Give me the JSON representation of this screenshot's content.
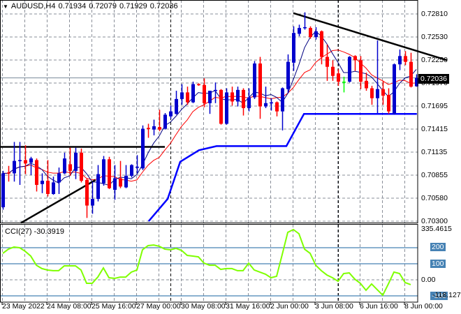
{
  "header": {
    "symbol": "AUDUSD,H4",
    "open": "0.71934",
    "high": "0.72079",
    "low": "0.71929",
    "close": "0.72036",
    "menu_icon": "triangle-down-icon"
  },
  "price_axis": {
    "labels": [
      "0.72810",
      "0.72530",
      "0.72250",
      "0.71970",
      "0.71695",
      "0.71415",
      "0.71135",
      "0.70855",
      "0.70580",
      "0.70300"
    ],
    "current": "0.72036",
    "current_value": 0.72036
  },
  "cci": {
    "title": "CCI(27) -30.3919",
    "max_label": "335.4615",
    "min_label": "-118.1278",
    "levels": [
      "200",
      "100",
      "0.00",
      "-100"
    ],
    "values": [
      165,
      191,
      204,
      200,
      178,
      148,
      91,
      70,
      61,
      57,
      57,
      87,
      87,
      87,
      61,
      -22,
      -22,
      17,
      74,
      13,
      9,
      17,
      17,
      48,
      61,
      187,
      213,
      217,
      209,
      191,
      187,
      196,
      183,
      152,
      148,
      143,
      104,
      91,
      91,
      65,
      70,
      70,
      57,
      57,
      104,
      61,
      48,
      35,
      13,
      22,
      157,
      296,
      313,
      287,
      191,
      165,
      91,
      57,
      30,
      13,
      -9,
      39,
      43,
      4,
      -22,
      -65,
      -26,
      -61,
      -96,
      -26,
      48,
      39,
      -17,
      -30.39
    ]
  },
  "time_axis": {
    "labels": [
      "23 May 2022",
      "24 May 08:00",
      "25 May 16:00",
      "27 May 00:00",
      "30 May 08:00",
      "31 May 16:00",
      "2 Jun 00:00",
      "3 Jun 08:00",
      "6 Jun 16:00",
      "8 Jun 00:00"
    ]
  },
  "colors": {
    "bull": "#0000cd",
    "bear": "#ff0000",
    "doji": "#00ff00",
    "fast_ma": "#000080",
    "slow_ma": "#ff0000",
    "stop_line": "#0000ff",
    "cci": "#7fff00",
    "level": "#4682b4"
  },
  "candles": [
    [
      0.7047,
      0.7091,
      0.7044,
      0.7088
    ],
    [
      0.7089,
      0.7097,
      0.7078,
      0.7088
    ],
    [
      0.7088,
      0.7126,
      0.7078,
      0.7103
    ],
    [
      0.7103,
      0.7126,
      0.7074,
      0.7104
    ],
    [
      0.7104,
      0.7122,
      0.7087,
      0.71
    ],
    [
      0.7101,
      0.7108,
      0.7086,
      0.7106
    ],
    [
      0.7104,
      0.7106,
      0.7066,
      0.7074
    ],
    [
      0.7075,
      0.7088,
      0.7064,
      0.7079
    ],
    [
      0.7079,
      0.7104,
      0.706,
      0.7063
    ],
    [
      0.7063,
      0.7084,
      0.7062,
      0.7077
    ],
    [
      0.7077,
      0.7095,
      0.7063,
      0.7088
    ],
    [
      0.7088,
      0.7113,
      0.7087,
      0.7106
    ],
    [
      0.7099,
      0.7119,
      0.7085,
      0.7091
    ],
    [
      0.7091,
      0.7119,
      0.7081,
      0.7113
    ],
    [
      0.7113,
      0.7118,
      0.7077,
      0.7079
    ],
    [
      0.708,
      0.7082,
      0.7034,
      0.7049
    ],
    [
      0.7049,
      0.7078,
      0.7039,
      0.7057
    ],
    [
      0.7057,
      0.7098,
      0.7054,
      0.7087
    ],
    [
      0.7076,
      0.7109,
      0.7073,
      0.7105
    ],
    [
      0.7105,
      0.7108,
      0.7069,
      0.707
    ],
    [
      0.7068,
      0.7098,
      0.7056,
      0.7082
    ],
    [
      0.7082,
      0.7103,
      0.707,
      0.7072
    ],
    [
      0.7071,
      0.7098,
      0.707,
      0.7085
    ],
    [
      0.7085,
      0.7099,
      0.7083,
      0.7098
    ],
    [
      0.7095,
      0.711,
      0.7088,
      0.7096
    ],
    [
      0.7094,
      0.7146,
      0.7092,
      0.7142
    ],
    [
      0.7143,
      0.7148,
      0.7131,
      0.7142
    ],
    [
      0.7141,
      0.7153,
      0.7134,
      0.7145
    ],
    [
      0.7144,
      0.7165,
      0.7139,
      0.7141
    ],
    [
      0.7142,
      0.7161,
      0.7141,
      0.7159
    ],
    [
      0.7157,
      0.717,
      0.7154,
      0.7163
    ],
    [
      0.716,
      0.7188,
      0.7159,
      0.7178
    ],
    [
      0.7178,
      0.7196,
      0.7171,
      0.7186
    ],
    [
      0.7186,
      0.7193,
      0.7171,
      0.7174
    ],
    [
      0.7174,
      0.7199,
      0.7173,
      0.7196
    ],
    [
      0.7196,
      0.7197,
      0.7194,
      0.7195
    ],
    [
      0.7195,
      0.7203,
      0.7168,
      0.7173
    ],
    [
      0.7173,
      0.7188,
      0.716,
      0.7188
    ],
    [
      0.7188,
      0.7198,
      0.7173,
      0.7189
    ],
    [
      0.7189,
      0.719,
      0.7147,
      0.7148
    ],
    [
      0.7148,
      0.7191,
      0.7147,
      0.7186
    ],
    [
      0.7186,
      0.7193,
      0.717,
      0.7175
    ],
    [
      0.7175,
      0.7193,
      0.7169,
      0.7189
    ],
    [
      0.7189,
      0.7191,
      0.7158,
      0.7167
    ],
    [
      0.7167,
      0.7191,
      0.7163,
      0.718
    ],
    [
      0.718,
      0.7224,
      0.7178,
      0.7221
    ],
    [
      0.7221,
      0.7229,
      0.7154,
      0.7169
    ],
    [
      0.7169,
      0.7193,
      0.7167,
      0.7173
    ],
    [
      0.7173,
      0.7179,
      0.7164,
      0.7174
    ],
    [
      0.7174,
      0.7175,
      0.7157,
      0.7163
    ],
    [
      0.7163,
      0.7192,
      0.714,
      0.7191
    ],
    [
      0.719,
      0.7232,
      0.7185,
      0.7223
    ],
    [
      0.7222,
      0.7266,
      0.7212,
      0.7258
    ],
    [
      0.7257,
      0.7268,
      0.7254,
      0.7264
    ],
    [
      0.7264,
      0.7283,
      0.7262,
      0.7265
    ],
    [
      0.7264,
      0.7266,
      0.7251,
      0.7253
    ],
    [
      0.7253,
      0.7265,
      0.725,
      0.726
    ],
    [
      0.726,
      0.7261,
      0.722,
      0.7229
    ],
    [
      0.7229,
      0.7244,
      0.72,
      0.7217
    ],
    [
      0.7217,
      0.7225,
      0.72,
      0.7206
    ],
    [
      0.7209,
      0.7214,
      0.7194,
      0.7199
    ],
    [
      0.7199,
      0.7205,
      0.7186,
      0.7199
    ],
    [
      0.7199,
      0.723,
      0.7198,
      0.7229
    ],
    [
      0.723,
      0.7231,
      0.7212,
      0.7225
    ],
    [
      0.7225,
      0.723,
      0.719,
      0.7199
    ],
    [
      0.72,
      0.721,
      0.7188,
      0.7191
    ],
    [
      0.7191,
      0.7194,
      0.7171,
      0.7179
    ],
    [
      0.7179,
      0.7249,
      0.7161,
      0.719
    ],
    [
      0.719,
      0.72,
      0.7171,
      0.7182
    ],
    [
      0.7183,
      0.7191,
      0.716,
      0.7163
    ],
    [
      0.716,
      0.7221,
      0.7159,
      0.722
    ],
    [
      0.722,
      0.7238,
      0.7213,
      0.723
    ],
    [
      0.723,
      0.7236,
      0.7219,
      0.7223
    ],
    [
      0.7223,
      0.7234,
      0.7192,
      0.7193
    ],
    [
      0.71934,
      0.72079,
      0.71929,
      0.72036
    ]
  ],
  "stop_line": [
    [
      26.1,
      0.703
    ],
    [
      29.5,
      0.7057
    ],
    [
      31.75,
      0.7102
    ],
    [
      35.1,
      0.7116
    ],
    [
      38.25,
      0.7121
    ],
    [
      50.75,
      0.7121
    ],
    [
      53.9,
      0.716
    ],
    [
      74.1,
      0.716
    ]
  ],
  "trendlines": [
    {
      "name": "resistance-horizontal",
      "points": [
        [
          -0.5,
          0.712
        ],
        [
          29,
          0.712
        ]
      ]
    },
    {
      "name": "support-diagonal",
      "points": [
        [
          3.25,
          0.7028
        ],
        [
          16.6,
          0.708
        ]
      ]
    },
    {
      "name": "descending-resistance",
      "points": [
        [
          52,
          0.7282
        ],
        [
          79.5,
          0.7225
        ]
      ]
    }
  ]
}
